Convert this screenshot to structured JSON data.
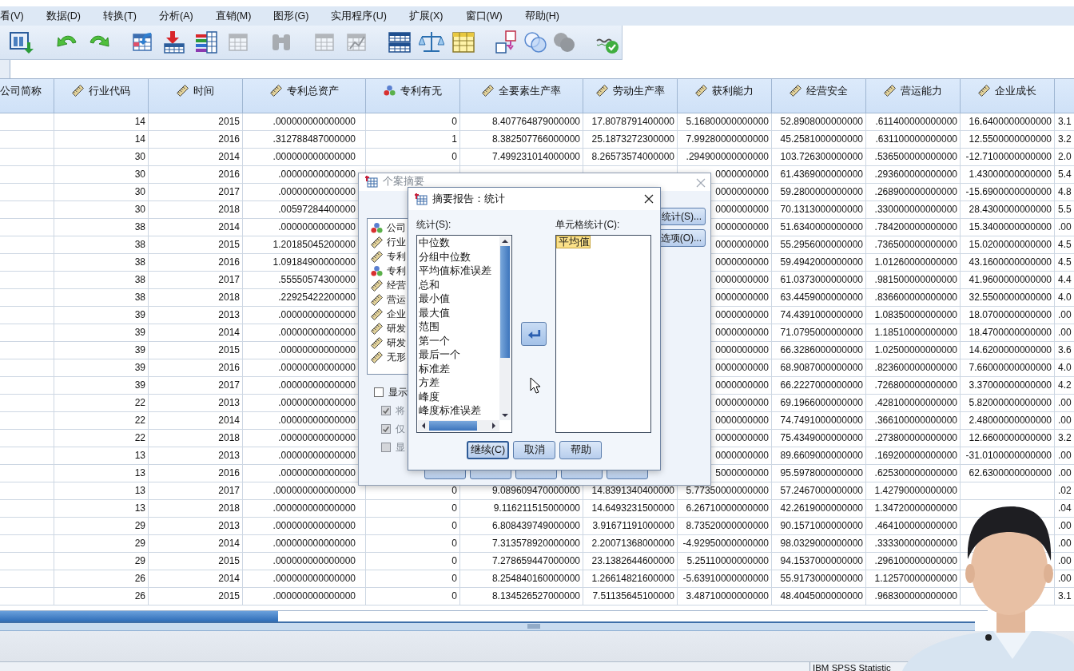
{
  "menu": [
    "看(V)",
    "数据(D)",
    "转换(T)",
    "分析(A)",
    "直销(M)",
    "图形(G)",
    "实用程序(U)",
    "扩展(X)",
    "窗口(W)",
    "帮助(H)"
  ],
  "toolbar": [
    {
      "disabled": false
    },
    {
      "disabled": false
    },
    {
      "disabled": false
    },
    {
      "disabled": false
    },
    {
      "disabled": false
    },
    {
      "disabled": false
    },
    {
      "disabled": true
    },
    {
      "disabled": true
    },
    {
      "disabled": true
    },
    {
      "disabled": true
    },
    {
      "disabled": false
    },
    {
      "disabled": false
    },
    {
      "disabled": false
    },
    {
      "disabled": false
    },
    {
      "disabled": false
    },
    {
      "disabled": true
    },
    {
      "disabled": false
    }
  ],
  "table": {
    "columns": [
      {
        "label": "公司简称",
        "kind": "none"
      },
      {
        "label": "行业代码",
        "kind": "scale"
      },
      {
        "label": "时间",
        "kind": "scale"
      },
      {
        "label": "专利总资产",
        "kind": "scale"
      },
      {
        "label": "专利有无",
        "kind": "nominal"
      },
      {
        "label": "全要素生产率",
        "kind": "scale"
      },
      {
        "label": "劳动生产率",
        "kind": "scale"
      },
      {
        "label": "获利能力",
        "kind": "scale"
      },
      {
        "label": "经营安全",
        "kind": "scale"
      },
      {
        "label": "营运能力",
        "kind": "scale"
      },
      {
        "label": "企业成长",
        "kind": "scale"
      }
    ],
    "rows": [
      [
        "",
        "14",
        "2015",
        ".000000000000000",
        "0",
        "8.407764879000000",
        "17.8078791400000",
        "5.16800000000000",
        "52.8908000000000",
        ".611400000000000",
        "16.6400000000000",
        "3.1"
      ],
      [
        "",
        "14",
        "2016",
        ".312788487000000",
        "1",
        "8.382507766000000",
        "25.1873272300000",
        "7.99280000000000",
        "45.2581000000000",
        ".631100000000000",
        "12.5500000000000",
        "3.2"
      ],
      [
        "",
        "30",
        "2014",
        ".000000000000000",
        "0",
        "7.499231014000000",
        "8.26573574000000",
        ".294900000000000",
        "103.726300000000",
        ".536500000000000",
        "-12.7100000000000",
        "2.0"
      ],
      [
        "",
        "30",
        "2016",
        ".00000000000000",
        null,
        null,
        null,
        "0000000000",
        "61.4369000000000",
        ".293600000000000",
        "1.43000000000000",
        "5.4"
      ],
      [
        "",
        "30",
        "2017",
        ".00000000000000",
        null,
        null,
        null,
        "0000000000",
        "59.2800000000000",
        ".268900000000000",
        "-15.6900000000000",
        "4.8"
      ],
      [
        "",
        "30",
        "2018",
        ".00597284400000",
        null,
        null,
        null,
        "0000000000",
        "70.1313000000000",
        ".330000000000000",
        "28.4300000000000",
        "5.5"
      ],
      [
        "",
        "38",
        "2014",
        ".00000000000000",
        null,
        null,
        null,
        "0000000000",
        "51.6340000000000",
        ".784200000000000",
        "15.3400000000000",
        ".00"
      ],
      [
        "",
        "38",
        "2015",
        "1.20185045200000",
        null,
        null,
        null,
        "0000000000",
        "55.2956000000000",
        ".736500000000000",
        "15.0200000000000",
        "4.5"
      ],
      [
        "",
        "38",
        "2016",
        "1.09184900000000",
        null,
        null,
        null,
        "0000000000",
        "59.4942000000000",
        "1.01260000000000",
        "43.1600000000000",
        "4.5"
      ],
      [
        "",
        "38",
        "2017",
        ".55550574300000",
        null,
        null,
        null,
        "0000000000",
        "61.0373000000000",
        ".981500000000000",
        "41.9600000000000",
        "4.4"
      ],
      [
        "",
        "38",
        "2018",
        ".22925422200000",
        null,
        null,
        null,
        "0000000000",
        "63.4459000000000",
        ".836600000000000",
        "32.5500000000000",
        "4.0"
      ],
      [
        "",
        "39",
        "2013",
        ".00000000000000",
        null,
        null,
        null,
        "0000000000",
        "74.4391000000000",
        "1.08350000000000",
        "18.0700000000000",
        ".00"
      ],
      [
        "",
        "39",
        "2014",
        ".00000000000000",
        null,
        null,
        null,
        "0000000000",
        "71.0795000000000",
        "1.18510000000000",
        "18.4700000000000",
        ".00"
      ],
      [
        "",
        "39",
        "2015",
        ".00000000000000",
        null,
        null,
        null,
        "0000000000",
        "66.3286000000000",
        "1.02500000000000",
        "14.6200000000000",
        "3.6"
      ],
      [
        "",
        "39",
        "2016",
        ".00000000000000",
        null,
        null,
        null,
        "0000000000",
        "68.9087000000000",
        ".823600000000000",
        "7.66000000000000",
        "4.0"
      ],
      [
        "",
        "39",
        "2017",
        ".00000000000000",
        null,
        null,
        null,
        "0000000000",
        "66.2227000000000",
        ".726800000000000",
        "3.37000000000000",
        "4.2"
      ],
      [
        "",
        "22",
        "2013",
        ".00000000000000",
        null,
        null,
        null,
        "0000000000",
        "69.1966000000000",
        ".428100000000000",
        "5.82000000000000",
        ".00"
      ],
      [
        "",
        "22",
        "2014",
        ".00000000000000",
        null,
        null,
        null,
        "0000000000",
        "74.7491000000000",
        ".366100000000000",
        "2.48000000000000",
        ".00"
      ],
      [
        "",
        "22",
        "2018",
        ".00000000000000",
        null,
        null,
        null,
        "0000000000",
        "75.4349000000000",
        ".273800000000000",
        "12.6600000000000",
        "3.2"
      ],
      [
        "",
        "13",
        "2013",
        ".00000000000000",
        null,
        null,
        null,
        "0000000000",
        "89.6609000000000",
        ".169200000000000",
        "-31.0100000000000",
        ".00"
      ],
      [
        "",
        "13",
        "2016",
        ".00000000000000",
        null,
        null,
        null,
        "5000000000",
        "95.5978000000000",
        ".625300000000000",
        "62.6300000000000",
        ".00"
      ],
      [
        "",
        "13",
        "2017",
        ".000000000000000",
        "0",
        "9.089609470000000",
        "14.8391340400000",
        "5.77350000000000",
        "57.2467000000000",
        "1.42790000000000",
        "",
        ".02"
      ],
      [
        "",
        "13",
        "2018",
        ".000000000000000",
        "0",
        "9.116211515000000",
        "14.6493231500000",
        "6.26710000000000",
        "42.2619000000000",
        "1.34720000000000",
        "",
        ".04"
      ],
      [
        "",
        "29",
        "2013",
        ".000000000000000",
        "0",
        "6.808439749000000",
        "3.91671191000000",
        "8.73520000000000",
        "90.1571000000000",
        ".464100000000000",
        "",
        ".00"
      ],
      [
        "",
        "29",
        "2014",
        ".000000000000000",
        "0",
        "7.313578920000000",
        "2.20071368000000",
        "-4.92950000000000",
        "98.0329000000000",
        ".333300000000000",
        "",
        ".00"
      ],
      [
        "",
        "29",
        "2015",
        ".000000000000000",
        "0",
        "7.278659447000000",
        "23.1382644600000",
        "5.25110000000000",
        "94.1537000000000",
        ".296100000000000",
        "",
        ".00"
      ],
      [
        "",
        "26",
        "2014",
        ".000000000000000",
        "0",
        "8.254840160000000",
        "1.26614821600000",
        "-5.63910000000000",
        "55.9173000000000",
        "1.12570000000000",
        "",
        ".00"
      ],
      [
        "",
        "26",
        "2015",
        ".000000000000000",
        "0",
        "8.134526527000000",
        "7.51135645100000",
        "3.48710000000000",
        "48.4045000000000",
        ".968300000000000",
        "",
        "3.1"
      ]
    ]
  },
  "case_summary_dialog": {
    "title": "个案摘要",
    "variables": [
      {
        "label": "公司",
        "kind": "nominal"
      },
      {
        "label": "行业",
        "kind": "scale"
      },
      {
        "label": "专利",
        "kind": "scale"
      },
      {
        "label": "专利",
        "kind": "nominal"
      },
      {
        "label": "经营",
        "kind": "scale"
      },
      {
        "label": "营运",
        "kind": "scale"
      },
      {
        "label": "企业",
        "kind": "scale"
      },
      {
        "label": "研发",
        "kind": "scale"
      },
      {
        "label": "研发",
        "kind": "scale"
      },
      {
        "label": "无形",
        "kind": "scale"
      }
    ],
    "options": [
      {
        "label": "显示",
        "checked": false,
        "disabled": false
      },
      {
        "label": "将",
        "checked": true,
        "disabled": true
      },
      {
        "label": "仅",
        "checked": true,
        "disabled": true
      },
      {
        "label": "显",
        "checked": false,
        "disabled": true
      }
    ],
    "side_buttons": [
      "统计(S)...",
      "选项(O)..."
    ]
  },
  "statistics_dialog": {
    "title": "摘要报告：统计",
    "statistics_label": "统计(S):",
    "statistics": [
      {
        "label": "中位数",
        "selected": false
      },
      {
        "label": "分组中位数",
        "selected": false
      },
      {
        "label": "平均值标准误差",
        "selected": false
      },
      {
        "label": "总和",
        "selected": false
      },
      {
        "label": "最小值",
        "selected": false
      },
      {
        "label": "最大值",
        "selected": false
      },
      {
        "label": "范围",
        "selected": false
      },
      {
        "label": "第一个",
        "selected": false
      },
      {
        "label": "最后一个",
        "selected": false
      },
      {
        "label": "标准差",
        "selected": false
      },
      {
        "label": "方差",
        "selected": false
      },
      {
        "label": "峰度",
        "selected": false
      },
      {
        "label": "峰度标准误差",
        "selected": false
      }
    ],
    "cell_statistics_label": "单元格统计(C):",
    "cell_statistics": [
      {
        "label": "平均值",
        "selected": true
      }
    ],
    "buttons": [
      {
        "label": "继续(C)",
        "default": true
      },
      {
        "label": "取消",
        "default": false
      },
      {
        "label": "帮助",
        "default": false
      }
    ]
  },
  "status_bar": {
    "text": "IBM SPSS Statistic"
  }
}
